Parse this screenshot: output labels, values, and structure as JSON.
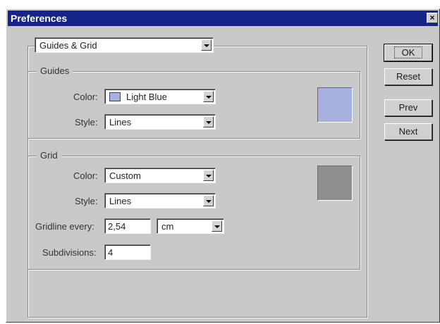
{
  "window": {
    "title": "Preferences",
    "close_glyph": "×"
  },
  "section_select": {
    "value": "Guides & Grid"
  },
  "guides": {
    "legend": "Guides",
    "color_label": "Color:",
    "color_value": "Light Blue",
    "color_chip": "#a7b1e0",
    "style_label": "Style:",
    "style_value": "Lines",
    "swatch_color": "#a7b1e0"
  },
  "grid": {
    "legend": "Grid",
    "color_label": "Color:",
    "color_value": "Custom",
    "style_label": "Style:",
    "style_value": "Lines",
    "gridline_label": "Gridline every:",
    "gridline_value": "2,54",
    "unit_value": "cm",
    "subdivisions_label": "Subdivisions:",
    "subdivisions_value": "4",
    "swatch_color": "#8f8f8f"
  },
  "buttons": {
    "ok": "OK",
    "reset": "Reset",
    "prev": "Prev",
    "next": "Next"
  },
  "icons": {
    "close": "close-icon",
    "dropdown": "chevron-down-icon"
  }
}
